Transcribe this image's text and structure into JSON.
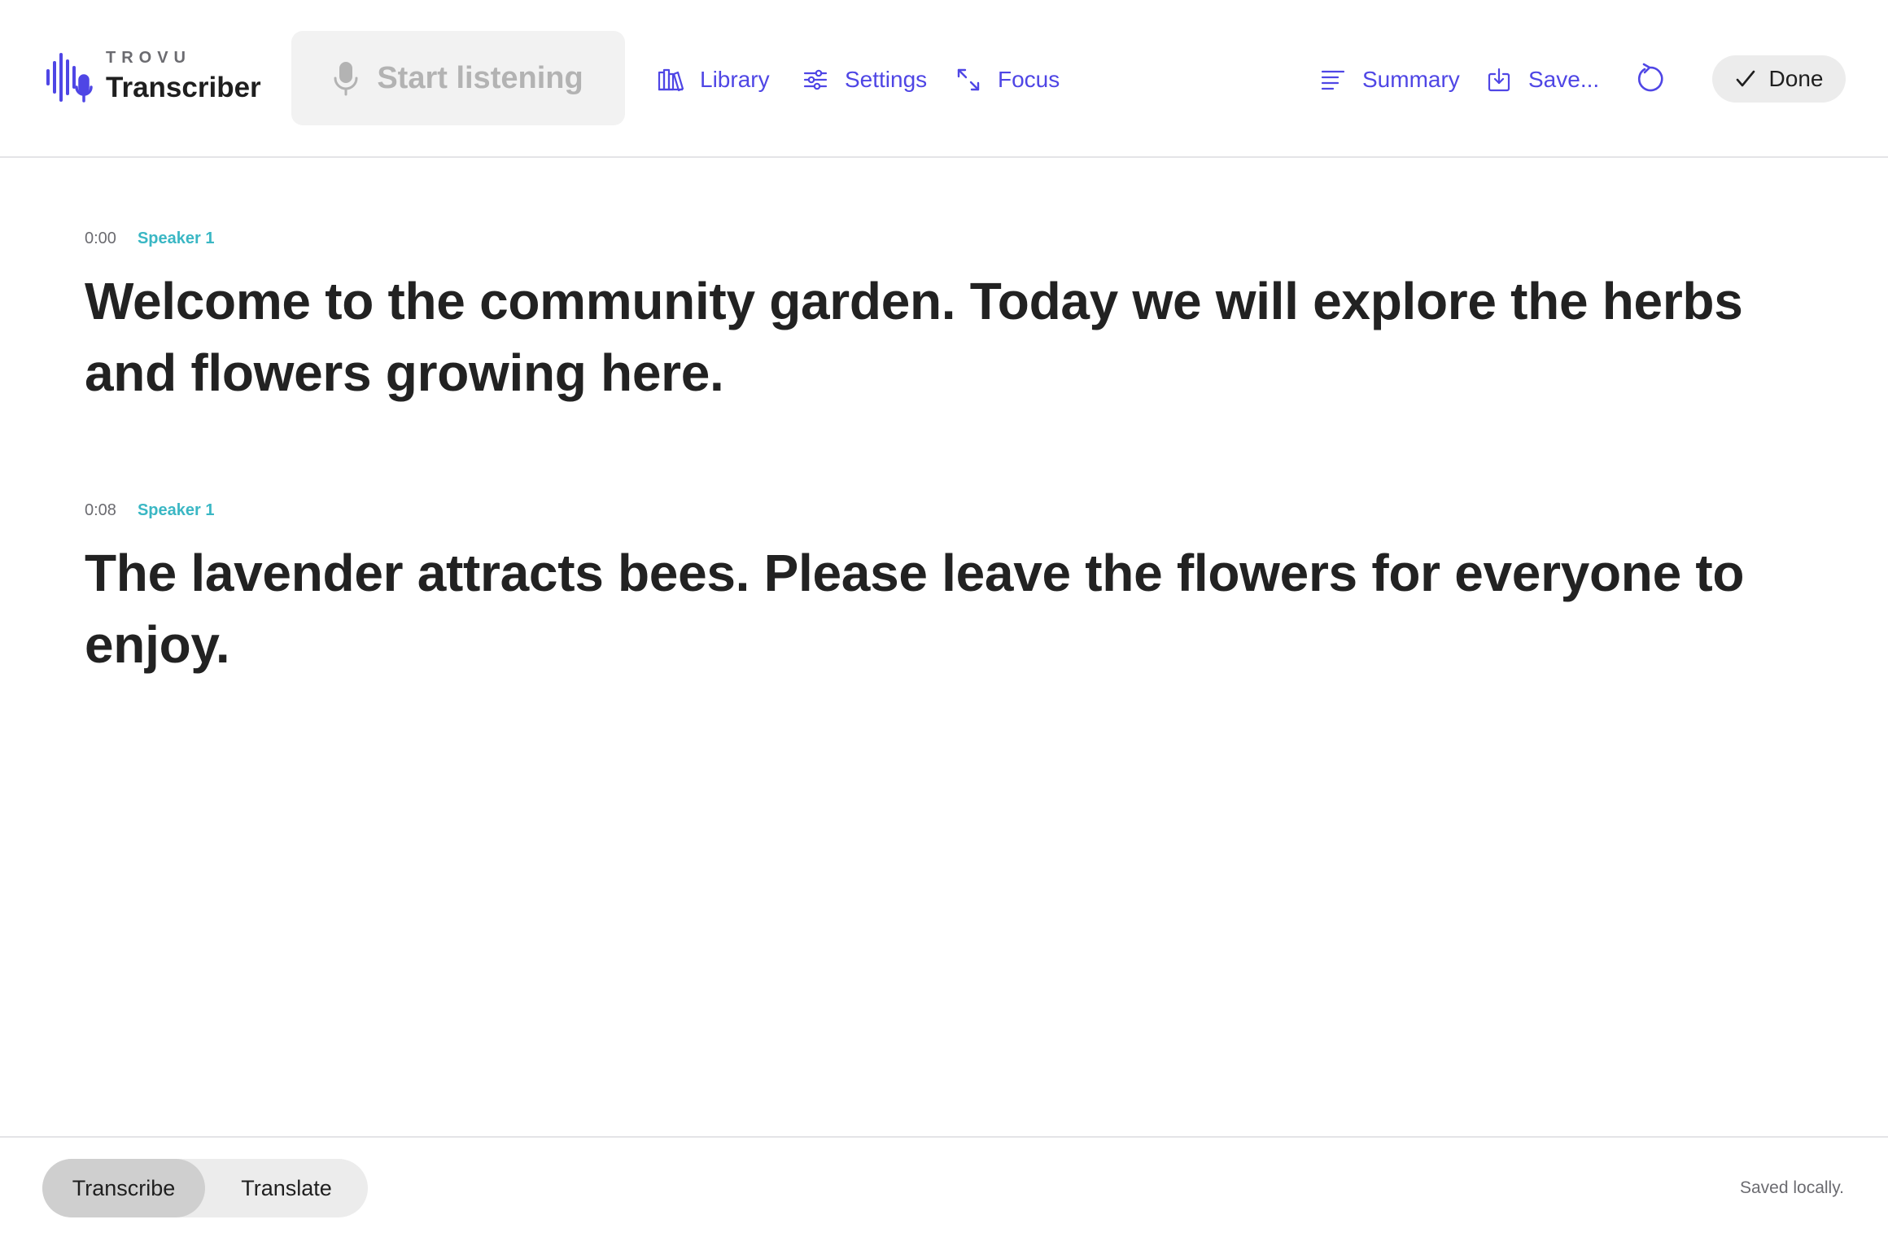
{
  "brand": {
    "eyebrow": "TROVU",
    "name": "Transcriber",
    "accent_color": "#4f46e5"
  },
  "toolbar": {
    "start_listening_label": "Start listening",
    "library_label": "Library",
    "settings_label": "Settings",
    "focus_label": "Focus",
    "summary_label": "Summary",
    "save_label": "Save...",
    "done_label": "Done",
    "icons": {
      "start_listening": "microphone-icon",
      "library": "books-icon",
      "settings": "sliders-icon",
      "focus": "expand-arrows-icon",
      "summary": "text-lines-icon",
      "save": "download-icon",
      "restart": "restart-icon",
      "done": "checkmark-icon"
    }
  },
  "transcript": {
    "segments": [
      {
        "time": "0:00",
        "speaker": "Speaker 1",
        "text": "Welcome to the community garden. Today we will explore the herbs and flowers growing here."
      },
      {
        "time": "0:08",
        "speaker": "Speaker 1",
        "text": "The lavender attracts bees. Please leave the flowers for everyone to enjoy."
      }
    ],
    "speaker_color": "#3ab7c4"
  },
  "footer": {
    "modes": [
      {
        "label": "Transcribe",
        "selected": true
      },
      {
        "label": "Translate",
        "selected": false
      }
    ],
    "status": "Saved locally."
  }
}
